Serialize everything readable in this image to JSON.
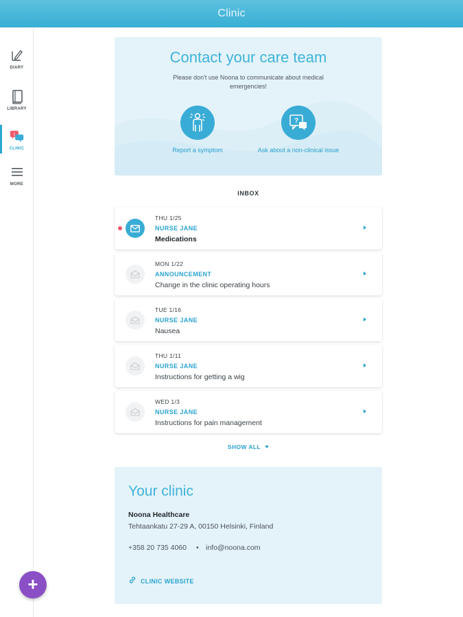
{
  "header": {
    "title": "Clinic"
  },
  "sidebar": {
    "items": [
      {
        "label": "DIARY",
        "icon": "diary-pen-icon"
      },
      {
        "label": "LIBRARY",
        "icon": "library-book-icon"
      },
      {
        "label": "CLINIC",
        "icon": "clinic-chat-icon",
        "active": true,
        "badge": "!"
      },
      {
        "label": "MORE",
        "icon": "menu-icon"
      }
    ]
  },
  "fab": {
    "label": "+"
  },
  "contact": {
    "title": "Contact your care team",
    "subtitle": "Please don't use Noona to communicate about medical emergencies!",
    "actions": [
      {
        "label": "Report a symptom",
        "icon": "person-symptom-icon"
      },
      {
        "label": "Ask about a non-clinical issue",
        "icon": "question-chat-icon"
      }
    ]
  },
  "inbox": {
    "title": "INBOX",
    "messages": [
      {
        "date": "THU 1/25",
        "sender": "NURSE JANE",
        "subject": "Medications",
        "unread": true
      },
      {
        "date": "MON 1/22",
        "sender": "ANNOUNCEMENT",
        "subject": "Change in the clinic operating hours",
        "unread": false
      },
      {
        "date": "TUE 1/16",
        "sender": "NURSE JANE",
        "subject": "Nausea",
        "unread": false
      },
      {
        "date": "THU 1/11",
        "sender": "NURSE JANE",
        "subject": "Instructions for getting a wig",
        "unread": false
      },
      {
        "date": "WED 1/3",
        "sender": "NURSE JANE",
        "subject": "Instructions for pain management",
        "unread": false
      }
    ],
    "show_all": "SHOW ALL"
  },
  "clinic": {
    "title": "Your clinic",
    "name": "Noona Healthcare",
    "address": "Tehtaankatu 27-29 A, 00150 Helsinki, Finland",
    "phone": "+358 20 735 4060",
    "separator": "•",
    "email": "info@noona.com",
    "website_label": "CLINIC WEBSITE"
  },
  "colors": {
    "accent": "#39acd6",
    "header": "#45b5da",
    "card_bg": "#e4f3f9",
    "fab": "#8a4fc4",
    "unread_dot": "#f0566a"
  }
}
